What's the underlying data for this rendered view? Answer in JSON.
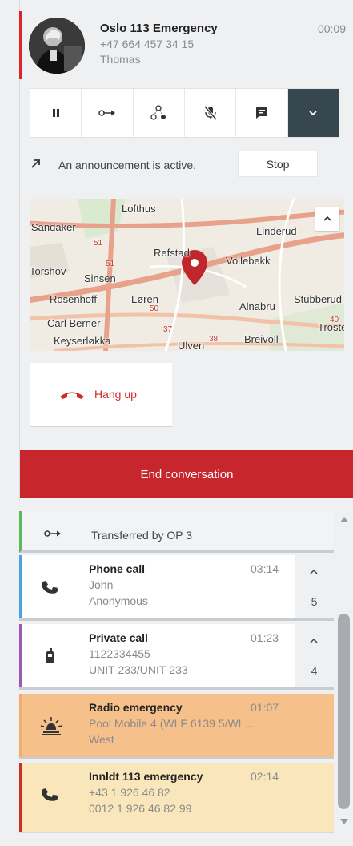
{
  "active_call": {
    "name": "Oslo 113 Emergency",
    "time": "00:09",
    "number": "+47 664 457 34 15",
    "person": "Thomas",
    "accent_color": "#d9262b"
  },
  "toolbar": {
    "buttons": [
      "pause-icon",
      "transfer-icon",
      "conference-icon",
      "mute-mic-icon",
      "message-icon",
      "chevron-down-icon"
    ]
  },
  "announcement": {
    "text": "An announcement is active.",
    "stop_label": "Stop"
  },
  "map": {
    "places": [
      "Lofthus",
      "Sandaker",
      "Linderud",
      "Refstad",
      "Vollebekk",
      "Torshov",
      "Sinsen",
      "Rosenhoff",
      "Løren",
      "Alnabru",
      "Stubberud",
      "Carl Berner",
      "Keyserløkka",
      "Ulven",
      "Breivoll",
      "Trosterud"
    ],
    "road_numbers": [
      "51",
      "51",
      "50",
      "37",
      "38",
      "40"
    ]
  },
  "hangup": {
    "label": "Hang up"
  },
  "end_conversation": {
    "label": "End conversation"
  },
  "queue": {
    "transferred": {
      "text": "Transferred by OP 3",
      "accent": "#5cb85c"
    },
    "items": [
      {
        "title": "Phone call",
        "time": "03:14",
        "line2": "John",
        "line3": "Anonymous",
        "count": "5",
        "accent": "#4aa3df",
        "icon": "phone-icon"
      },
      {
        "title": "Private call",
        "time": "01:23",
        "line2": "1122334455",
        "line3": "UNIT-233/UNIT-233",
        "count": "4",
        "accent": "#9b59b6",
        "icon": "radio-handset-icon"
      },
      {
        "title": "Radio emergency",
        "time": "01:07",
        "line2": "Pool Mobile 4 (WLF 6139 5/WL...",
        "line3": "West",
        "accent": "#f0ad6e",
        "icon": "emergency-light-icon"
      },
      {
        "title": "Innldt 113 emergency",
        "time": "02:14",
        "line2": "+43 1 926 46 82",
        "line3": "0012 1 926 46 82 99",
        "accent": "#c9302c",
        "icon": "phone-icon"
      }
    ]
  }
}
